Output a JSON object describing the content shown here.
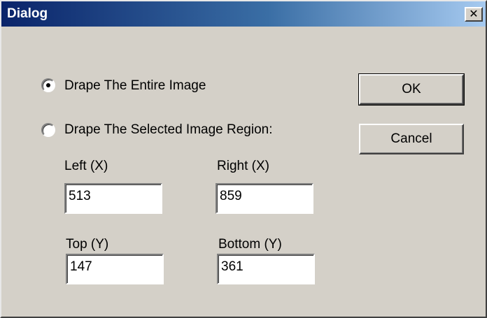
{
  "window": {
    "title": "Dialog",
    "close_glyph": "✕"
  },
  "options": {
    "entire_image": {
      "label": "Drape The Entire Image",
      "selected": true
    },
    "selected_region": {
      "label": "Drape The Selected Image Region:",
      "selected": false
    }
  },
  "fields": {
    "left": {
      "label": "Left (X)",
      "value": "513"
    },
    "right": {
      "label": "Right (X)",
      "value": "859"
    },
    "top": {
      "label": "Top (Y)",
      "value": "147"
    },
    "bottom": {
      "label": "Bottom (Y)",
      "value": "361"
    }
  },
  "buttons": {
    "ok": "OK",
    "cancel": "Cancel"
  }
}
